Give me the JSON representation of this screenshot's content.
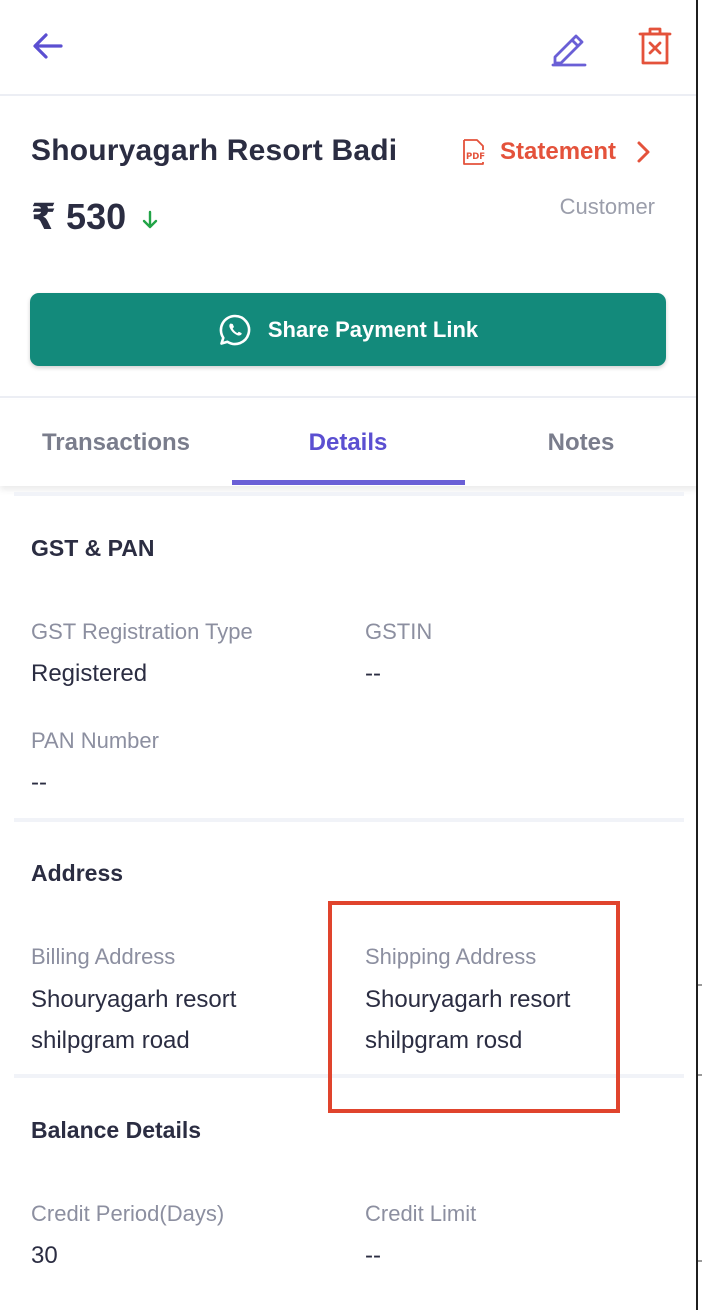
{
  "header": {
    "back_icon": "arrow-left-icon",
    "edit_icon": "pencil-icon",
    "delete_icon": "trash-icon"
  },
  "party": {
    "name": "Shouryagarh Resort Badi",
    "statement_label": "Statement",
    "amount": "₹ 530",
    "type": "Customer",
    "share_button_label": "Share Payment Link"
  },
  "tabs": [
    {
      "label": "Transactions",
      "active": false
    },
    {
      "label": "Details",
      "active": true
    },
    {
      "label": "Notes",
      "active": false
    }
  ],
  "gst_pan": {
    "title": "GST & PAN",
    "gst_type_label": "GST Registration Type",
    "gst_type_value": "Registered",
    "gstin_label": "GSTIN",
    "gstin_value": "--",
    "pan_label": "PAN Number",
    "pan_value": "--"
  },
  "address": {
    "title": "Address",
    "billing_label": "Billing Address",
    "billing_line1": "Shouryagarh resort",
    "billing_line2": "shilpgram road",
    "shipping_label": "Shipping Address",
    "shipping_line1": "Shouryagarh resort",
    "shipping_line2": "shilpgram rosd"
  },
  "balance": {
    "title": "Balance Details",
    "credit_period_label": "Credit Period(Days)",
    "credit_period_value": "30",
    "credit_limit_label": "Credit Limit",
    "credit_limit_value": "--"
  },
  "colors": {
    "accent": "#5b4fd1",
    "statement": "#e4523b",
    "share_button": "#138a7b",
    "delete": "#e4523b",
    "amount_arrow": "#22a447",
    "highlight": "#e0442d"
  }
}
